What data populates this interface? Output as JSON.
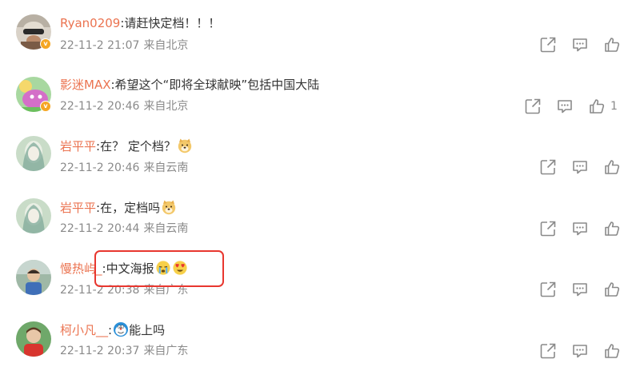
{
  "comments": [
    {
      "username": "Ryan0209",
      "text": "请赶快定档！！！",
      "time": "22-11-2 21:07",
      "location": "来自北京",
      "likes": ""
    },
    {
      "username": "影迷MAX",
      "text": "希望这个“即将全球献映”包括中国大陆",
      "time": "22-11-2 20:46",
      "location": "来自北京",
      "likes": "1"
    },
    {
      "username": "岩平平",
      "text": "在？ 定个档？",
      "time": "22-11-2 20:46",
      "location": "来自云南",
      "likes": "",
      "emoji_after": [
        "doge-emoji"
      ]
    },
    {
      "username": "岩平平",
      "text": "在，定档吗",
      "time": "22-11-2 20:44",
      "location": "来自云南",
      "likes": "",
      "emoji_after": [
        "doge-emoji"
      ]
    },
    {
      "username": "慢热屿_",
      "text": "中文海报",
      "time": "22-11-2 20:38",
      "location": "来自广东",
      "likes": "",
      "emoji_after": [
        "crying-emoji",
        "heart-eyes-emoji"
      ]
    },
    {
      "username": "柯小凡__",
      "text": "能上吗",
      "time": "22-11-2 20:37",
      "location": "来自广东",
      "likes": "",
      "emoji_before": [
        "doraemon-emoji"
      ]
    }
  ],
  "separator": ":",
  "colors": {
    "username": "#eb7350",
    "meta": "#8a8a8a",
    "icon": "#8a8a8a",
    "highlight": "#e8372f",
    "verified_badge": "#f5a623"
  },
  "icons": {
    "share": "share-icon",
    "comment": "comment-icon",
    "like": "like-icon",
    "verified": "verified-badge-icon"
  }
}
